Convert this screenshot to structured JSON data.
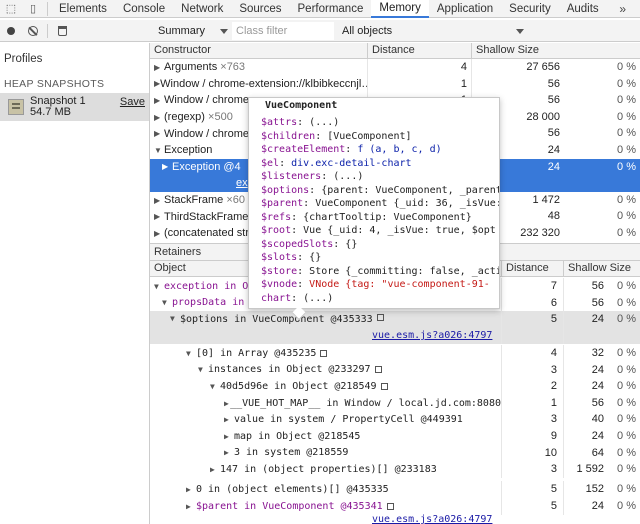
{
  "tabs": [
    "Elements",
    "Console",
    "Network",
    "Sources",
    "Performance",
    "Memory",
    "Application",
    "Security",
    "Audits"
  ],
  "active_tab": "Memory",
  "overflow_label": "»",
  "toolbar": {
    "view_select": "Summary",
    "filter_placeholder": "Class filter",
    "objects_select": "All objects"
  },
  "sidebar": {
    "profiles_label": "Profiles",
    "heap_header": "HEAP SNAPSHOTS",
    "snapshot_name": "Snapshot 1",
    "snapshot_size": "54.7 MB",
    "save_label": "Save"
  },
  "constructor_table": {
    "headers": [
      "Constructor",
      "Distance",
      "Shallow Size",
      ""
    ],
    "rows": [
      {
        "name": "Arguments",
        "count": "×763",
        "distance": "4",
        "size": "27 656",
        "pct": "0 %"
      },
      {
        "name": "Window / chrome-extension://klbibkeccnjl…",
        "count": "",
        "distance": "1",
        "size": "56",
        "pct": "0 %"
      },
      {
        "name": "Window / chrome-ex",
        "count": "",
        "distance": "1",
        "size": "56",
        "pct": "0 %"
      },
      {
        "name": "(regexp)",
        "count": "×500",
        "distance": "",
        "size": "28 000",
        "pct": "0 %"
      },
      {
        "name": "Window / chrome-ex",
        "count": "",
        "distance": "1",
        "size": "56",
        "pct": "0 %"
      },
      {
        "name": "Exception",
        "count": "",
        "distance": "",
        "size": "24",
        "pct": "0 %"
      },
      {
        "name": "Exception @4",
        "count": "",
        "distance": "",
        "size": "24",
        "pct": "0 %"
      },
      {
        "name": "ex",
        "count": "",
        "distance": "",
        "size": "",
        "pct": ""
      },
      {
        "name": "StackFrame",
        "count": "×60",
        "distance": "",
        "size": "1 472",
        "pct": "0 %"
      },
      {
        "name": "ThirdStackFrame",
        "count": "",
        "distance": "",
        "size": "48",
        "pct": "0 %"
      },
      {
        "name": "(concatenated strin",
        "count": "",
        "distance": "",
        "size": "232 320",
        "pct": "0 %"
      }
    ]
  },
  "retainers": {
    "label": "Retainers",
    "headers": [
      "Object",
      "Distance",
      "Shallow Size",
      ""
    ],
    "rows": [
      {
        "text": "exception in O",
        "distance": "7",
        "size": "56",
        "pct": "0 %"
      },
      {
        "text": "propsData in",
        "distance": "6",
        "size": "56",
        "pct": "0 %"
      },
      {
        "text": "$options in VueComponent @435333",
        "distance": "5",
        "size": "24",
        "pct": "0 %"
      },
      {
        "text": "vue.esm.js?a026:4797",
        "distance": "",
        "size": "",
        "pct": ""
      },
      {
        "text": "[0] in Array @435235",
        "distance": "4",
        "size": "32",
        "pct": "0 %"
      },
      {
        "text": "instances in Object @233297",
        "distance": "3",
        "size": "24",
        "pct": "0 %"
      },
      {
        "text": "40d5d96e in Object @218549",
        "distance": "2",
        "size": "24",
        "pct": "0 %"
      },
      {
        "text": "__VUE_HOT_MAP__ in Window / local.jd.com:8080",
        "distance": "1",
        "size": "56",
        "pct": "0 %"
      },
      {
        "text": "value in system / PropertyCell @449391",
        "distance": "3",
        "size": "40",
        "pct": "0 %"
      },
      {
        "text": "map in Object @218545",
        "distance": "9",
        "size": "24",
        "pct": "0 %"
      },
      {
        "text": "3 in system @218559",
        "distance": "10",
        "size": "64",
        "pct": "0 %"
      },
      {
        "text": "147 in (object properties)[] @233183",
        "distance": "3",
        "size": "1 592",
        "pct": "0 %"
      },
      {
        "text": "0 in (object elements)[] @435335",
        "distance": "5",
        "size": "152",
        "pct": "0 %"
      },
      {
        "text": "$parent in VueComponent @435341",
        "distance": "5",
        "size": "24",
        "pct": "0 %"
      },
      {
        "text": "vue.esm.js?a026:4797",
        "distance": "",
        "size": "",
        "pct": ""
      }
    ]
  },
  "popover": {
    "title": "VueComponent",
    "lines": [
      {
        "k": "$attrs",
        "v": "(...)"
      },
      {
        "k": "$children",
        "v": "[VueComponent]"
      },
      {
        "k": "$createElement",
        "v": "f (a, b, c, d)"
      },
      {
        "k": "$el",
        "v": "div.exc-detail-chart"
      },
      {
        "k": "$listeners",
        "v": "(...)"
      },
      {
        "k": "$options",
        "v": "{parent: VueComponent, _parentV"
      },
      {
        "k": "$parent",
        "v": "VueComponent {_uid: 36, _isVue:"
      },
      {
        "k": "$refs",
        "v": "{chartTooltip: VueComponent}"
      },
      {
        "k": "$root",
        "v": "Vue {_uid: 4, _isVue: true, $opt"
      },
      {
        "k": "$scopedSlots",
        "v": "{}"
      },
      {
        "k": "$slots",
        "v": "{}"
      },
      {
        "k": "$store",
        "v": "Store {_committing: false, _acti"
      },
      {
        "k": "$vnode",
        "v": "VNode {tag: \"vue-component-91-"
      },
      {
        "k": "chart",
        "v": "(...)"
      }
    ]
  },
  "colors": {
    "accent": "#3879d9",
    "prop": "#881391",
    "link": "#1a1aa6"
  }
}
